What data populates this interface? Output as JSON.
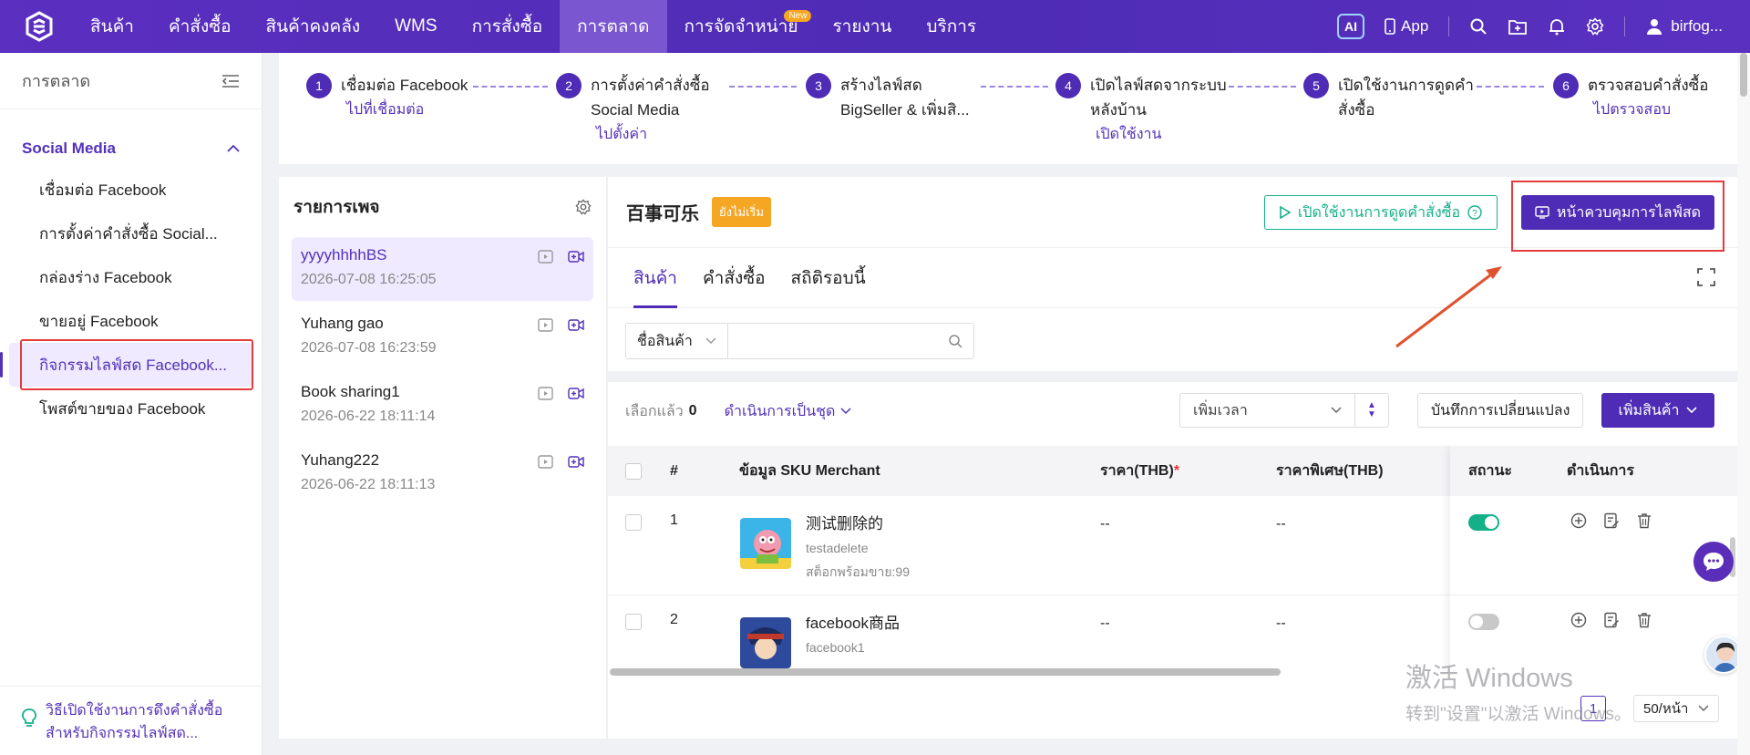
{
  "nav": {
    "items": [
      {
        "label": "สินค้า"
      },
      {
        "label": "คำสั่งซื้อ"
      },
      {
        "label": "สินค้าคงคลัง"
      },
      {
        "label": "WMS"
      },
      {
        "label": "การสั่งซื้อ"
      },
      {
        "label": "การตลาด",
        "active": true
      },
      {
        "label": "การจัดจำหน่าย",
        "badge": "New"
      },
      {
        "label": "รายงาน"
      },
      {
        "label": "บริการ"
      }
    ],
    "ai_label": "AI",
    "app_label": "App",
    "user_name": "birfog..."
  },
  "sidebar": {
    "title": "การตลาด",
    "group": "Social Media",
    "items": [
      {
        "label": "เชื่อมต่อ Facebook"
      },
      {
        "label": "การตั้งค่าคำสั่งซื้อ Social..."
      },
      {
        "label": "กล่องร่าง Facebook"
      },
      {
        "label": "ขายอยู่ Facebook"
      },
      {
        "label": "กิจกรรมไลฟ์สด Facebook...",
        "active": true
      },
      {
        "label": "โพสต์ขายของ Facebook"
      }
    ],
    "footer_line1": "วิธีเปิดใช้งานการดึงคำสั่งซื้อ",
    "footer_line2": "สำหรับกิจกรรมไลฟ์สด..."
  },
  "steps": [
    {
      "num": "1",
      "line1": "เชื่อมต่อ Facebook",
      "line2": "",
      "link": "ไปที่เชื่อมต่อ"
    },
    {
      "num": "2",
      "line1": "การตั้งค่าคำสั่งซื้อ",
      "line2": "Social Media",
      "link": "ไปตั้งค่า"
    },
    {
      "num": "3",
      "line1": "สร้างไลฟ์สด",
      "line2": "BigSeller & เพิ่มสิ...",
      "link": ""
    },
    {
      "num": "4",
      "line1": "เปิดไลฟ์สดจากระบบ",
      "line2": "หลังบ้าน",
      "link": "เปิดใช้งาน"
    },
    {
      "num": "5",
      "line1": "เปิดใช้งานการดูดคำ",
      "line2": "สั่งซื้อ",
      "link": ""
    },
    {
      "num": "6",
      "line1": "ตรวจสอบคำสั่งซื้อ",
      "line2": "",
      "link": "ไปตรวจสอบ"
    }
  ],
  "pagelist": {
    "title": "รายการเพจ",
    "items": [
      {
        "name": "yyyyhhhhBS",
        "time": "2026-07-08 16:25:05"
      },
      {
        "name": "Yuhang gao",
        "time": "2026-07-08 16:23:59"
      },
      {
        "name": "Book sharing1",
        "time": "2026-06-22 18:11:14"
      },
      {
        "name": "Yuhang222",
        "time": "2026-06-22 18:11:13"
      }
    ]
  },
  "main": {
    "title": "百事可乐",
    "status": "ยังไม่เริ่ม",
    "enable_btn": "เปิดใช้งานการดูดคำสั่งซื้อ",
    "live_btn": "หน้าควบคุมการไลฟ์สด",
    "tabs": [
      {
        "label": "สินค้า"
      },
      {
        "label": "คำสั่งซื้อ"
      },
      {
        "label": "สถิติรอบนี้"
      }
    ],
    "filter_field": "ชื่อสินค้า",
    "filter_value": "",
    "selected_label": "เลือกแล้ว",
    "selected_count": "0",
    "bulk_label": "ดำเนินการเป็นชุด",
    "sort_label": "เพิ่มเวลา",
    "save_btn": "บันทึกการเปลี่ยนแปลง",
    "add_btn": "เพิ่มสินค้า",
    "columns": {
      "no": "#",
      "sku": "ข้อมูล SKU Merchant",
      "price": "ราคา(THB)",
      "price_required": "*",
      "special": "ราคาพิเศษ(THB)",
      "status": "สถานะ",
      "actions": "ดำเนินการ"
    },
    "rows": [
      {
        "no": "1",
        "name": "测试删除的",
        "sku": "testadelete",
        "stock": "สต็อกพร้อมขาย:99",
        "price": "--",
        "special": "--",
        "enabled": true
      },
      {
        "no": "2",
        "name": "facebook商品",
        "sku": "facebook1",
        "stock": "",
        "price": "--",
        "special": "--",
        "enabled": false
      }
    ],
    "page_current": "1",
    "page_size": "50/หน้า"
  },
  "watermark": {
    "line1": "激活 Windows",
    "line2": "转到\"设置\"以激活 Windows。"
  },
  "colors": {
    "brand": "#4e2cb5",
    "accent_green": "#14b08a",
    "warning": "#f5a623",
    "highlight": "#e43c3c"
  }
}
